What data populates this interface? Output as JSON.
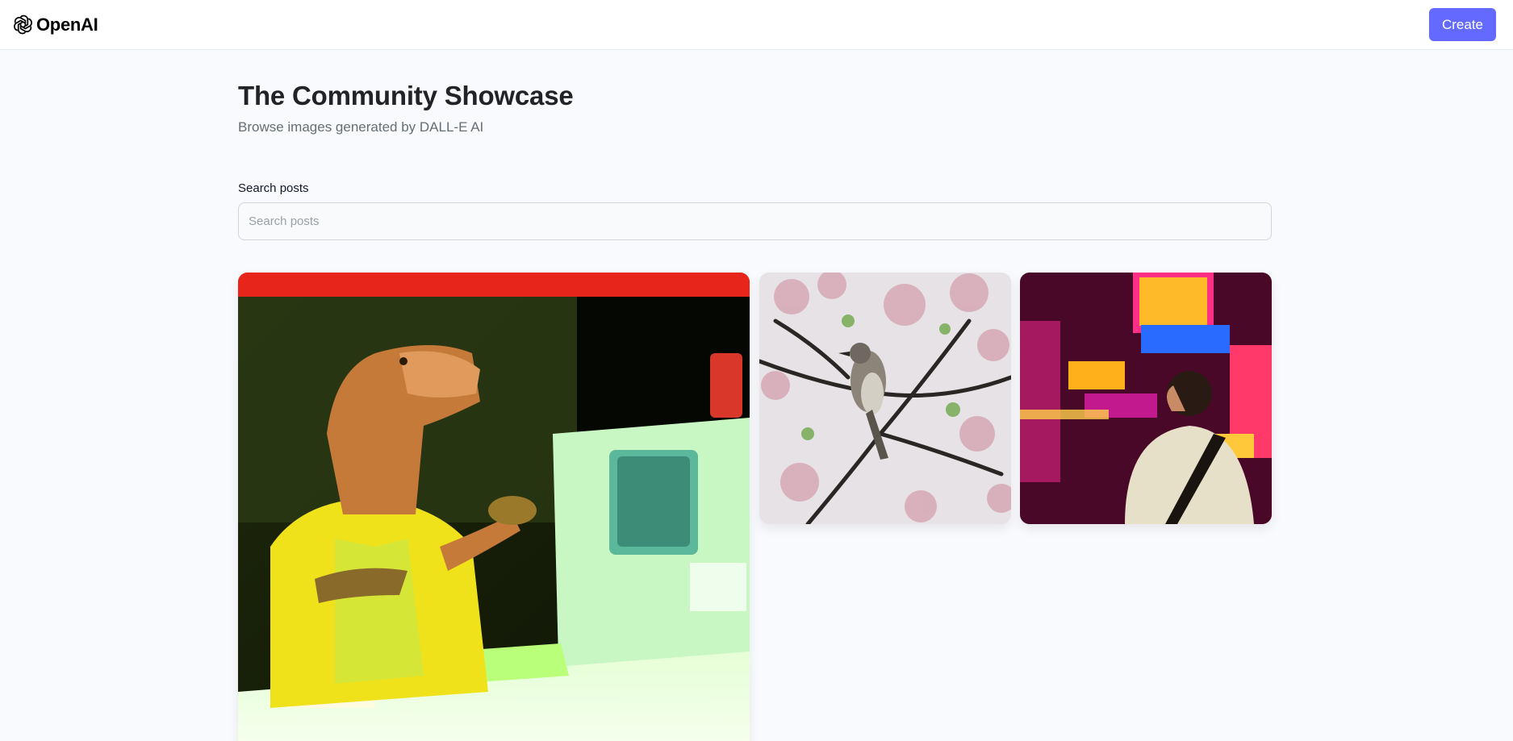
{
  "header": {
    "logo_text": "OpenAI",
    "create_label": "Create"
  },
  "main": {
    "title": "The Community Showcase",
    "subtitle": "Browse images generated by DALL-E AI"
  },
  "search": {
    "label": "Search posts",
    "placeholder": "Search posts",
    "value": ""
  },
  "posts": [
    {
      "image": "dinosaur-cashier-image"
    },
    {
      "image": "bird-on-cherry-blossom-image"
    },
    {
      "image": "man-in-neon-city-image"
    }
  ],
  "colors": {
    "accent": "#6469ff",
    "background": "#f9fafe",
    "title": "#222328",
    "subtitle": "#666e75"
  }
}
